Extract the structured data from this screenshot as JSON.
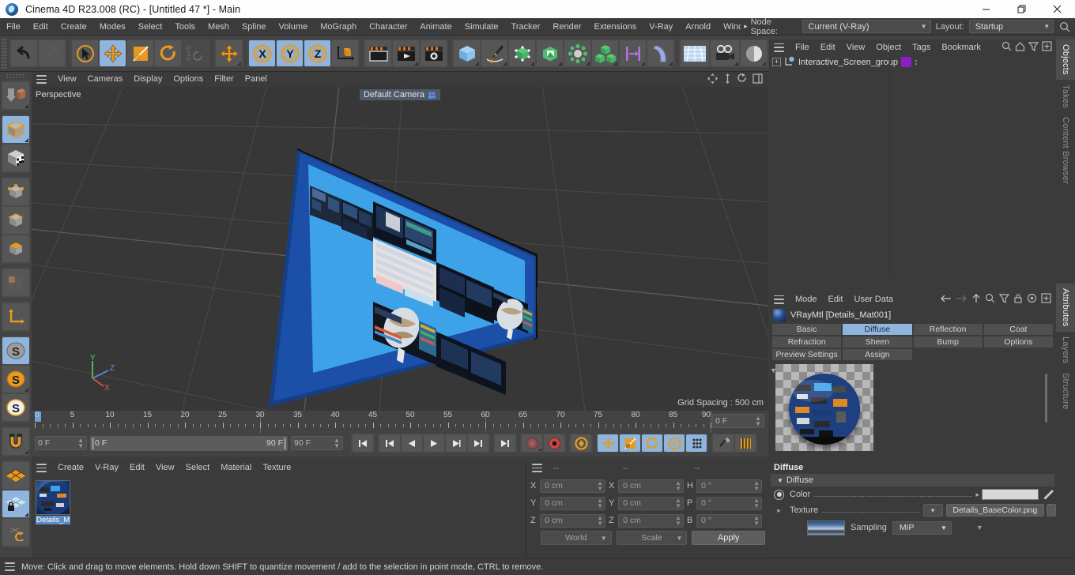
{
  "window": {
    "title": "Cinema 4D R23.008 (RC) - [Untitled 47 *] - Main",
    "minimize": "minimize-icon",
    "maximize": "restore-icon",
    "close": "close-icon"
  },
  "menubar": {
    "items": [
      "File",
      "Edit",
      "Create",
      "Modes",
      "Select",
      "Tools",
      "Mesh",
      "Spline",
      "Volume",
      "MoGraph",
      "Character",
      "Animate",
      "Simulate",
      "Tracker",
      "Render",
      "Extensions",
      "V-Ray",
      "Arnold",
      "Wind"
    ],
    "overflow": "▸",
    "node_space_label": "Node Space:",
    "node_space_value": "Current (V-Ray)",
    "layout_label": "Layout:",
    "layout_value": "Startup",
    "search_icon": "search-icon"
  },
  "toolbar": {
    "undo": "undo-icon",
    "redo": "redo-icon",
    "select": "live-selection-icon",
    "move": "move-icon",
    "scale": "scale-icon",
    "rotate": "rotate-icon",
    "psr": "psr-icon",
    "move_dup": "move-tool-icon",
    "axis_x": "X",
    "axis_y": "Y",
    "axis_z": "Z",
    "world_axis": "world-coordinate-icon",
    "render_view": "render-view-icon",
    "render_picture": "render-to-picture-viewer-icon",
    "render_settings": "render-settings-icon",
    "cube": "add-cube-icon",
    "spline_pen": "spline-pen-icon",
    "subdivision": "subdivision-surface-icon",
    "deformer": "deformer-icon",
    "mograph": "mograph-icon",
    "cloner": "cloner-icon",
    "array": "array-icon",
    "bend": "bend-deformer-icon",
    "floor": "floor-icon",
    "camera": "camera-icon",
    "light": "light-icon"
  },
  "leftbar": {
    "items": [
      {
        "name": "make-editable-icon",
        "active": false
      },
      {
        "name": "model-mode-icon",
        "active": true
      },
      {
        "name": "texture-mode-icon",
        "active": false
      },
      {
        "name": "point-mode-icon",
        "active": false
      },
      {
        "name": "edge-mode-icon",
        "active": false
      },
      {
        "name": "polygon-mode-icon",
        "active": false
      },
      {
        "name": "uv-mode-icon",
        "active": false
      },
      {
        "name": "axis-modification-icon",
        "active": false
      },
      {
        "name": "enable-axis-icon",
        "active": true
      },
      {
        "name": "world-object-axis-icon",
        "active": false
      },
      {
        "name": "object-axis-icon",
        "active": false
      },
      {
        "name": "snap-magnet-icon",
        "active": false
      },
      {
        "name": "workplane-icon",
        "active": false
      },
      {
        "name": "lock-workplane-icon",
        "active": true
      },
      {
        "name": "planar-workplane-icon",
        "active": false
      }
    ]
  },
  "viewport": {
    "menu": [
      "View",
      "Cameras",
      "Display",
      "Options",
      "Filter",
      "Panel"
    ],
    "burger": "viewport-menu-icon",
    "right_icons": [
      "move-view-icon",
      "pan-view-icon",
      "rotate-view-icon",
      "maximize-view-icon"
    ],
    "perspective_label": "Perspective",
    "camera_label": "Default Camera",
    "camera_icon": "camera-badge-icon",
    "grid_spacing": "Grid Spacing : 500 cm",
    "axis": {
      "x": "X",
      "y": "Y",
      "z": "Z",
      "x_color": "#e05555",
      "y_color": "#5ed25e",
      "z_color": "#5b8ef0"
    },
    "bg_color": "#373737",
    "object_color": "#1b4fa8",
    "screen_color": "#3ea2e8"
  },
  "timeline": {
    "ticks": [
      0,
      5,
      10,
      15,
      20,
      25,
      30,
      35,
      40,
      45,
      50,
      55,
      60,
      65,
      70,
      75,
      80,
      85,
      90
    ],
    "current_frame": "0 F",
    "start_frame": "0 F",
    "preview_start": "0 F",
    "preview_end": "90 F",
    "end_frame": "90 F",
    "buttons": [
      {
        "name": "go-to-start-button",
        "icon": "◀|",
        "active": false
      },
      {
        "name": "go-to-previous-key-button",
        "icon": "|◀",
        "active": false
      },
      {
        "name": "go-to-previous-frame-button",
        "icon": "◀◀",
        "active": false
      },
      {
        "name": "play-button",
        "icon": "▶",
        "active": false
      },
      {
        "name": "go-to-next-frame-button",
        "icon": "▶▶",
        "active": false
      },
      {
        "name": "go-to-next-key-button",
        "icon": "▶|",
        "active": false
      },
      {
        "name": "go-to-end-button",
        "icon": "|▶",
        "active": false
      }
    ],
    "record_tools": [
      "record-active-objects-icon",
      "autokeying-icon",
      "keyframe-selection-icon",
      "position-key-icon",
      "scale-key-icon",
      "rotation-key-icon",
      "parameter-key-icon",
      "point-level-animation-icon"
    ],
    "extra_tools": [
      "sound-icon",
      "timeline-icon"
    ]
  },
  "material_manager": {
    "menu": [
      "Create",
      "V-Ray",
      "Edit",
      "View",
      "Select",
      "Material",
      "Texture"
    ],
    "burger": "material-menu-icon",
    "materials": [
      {
        "name": "Details_M",
        "selected": true
      }
    ]
  },
  "coordinates": {
    "burger": "coordinates-menu-icon",
    "headers": [
      "--",
      "--",
      "--"
    ],
    "rows": [
      {
        "l1": "X",
        "v1": "0 cm",
        "l2": "X",
        "v2": "0 cm",
        "l3": "H",
        "v3": "0 °"
      },
      {
        "l1": "Y",
        "v1": "0 cm",
        "l2": "Y",
        "v2": "0 cm",
        "l3": "P",
        "v3": "0 °"
      },
      {
        "l1": "Z",
        "v1": "0 cm",
        "l2": "Z",
        "v2": "0 cm",
        "l3": "B",
        "v3": "0 °"
      }
    ],
    "system": "World",
    "mode": "Scale",
    "apply": "Apply"
  },
  "object_manager": {
    "menu": [
      "File",
      "Edit",
      "View",
      "Object",
      "Tags",
      "Bookmarks"
    ],
    "burger": "object-manager-menu-icon",
    "right_icons": [
      "search-icon",
      "home-icon",
      "filter-icon",
      "add-icon"
    ],
    "objects": [
      {
        "name": "Interactive_Screen_group",
        "expand": "+",
        "tag_color": "#8a1fc8"
      }
    ]
  },
  "attributes": {
    "menu": [
      "Mode",
      "Edit",
      "User Data"
    ],
    "burger": "attributes-menu-icon",
    "right_icons": [
      "back-arrow-icon",
      "forward-arrow-icon",
      "up-arrow-icon",
      "search-icon",
      "filter-icon",
      "lock-icon",
      "target-icon",
      "add-icon"
    ],
    "object_title": "VRayMtl [Details_Mat001]",
    "tabs": [
      {
        "label": "Basic",
        "active": false
      },
      {
        "label": "Diffuse",
        "active": true
      },
      {
        "label": "Reflection",
        "active": false
      },
      {
        "label": "Coat",
        "active": false
      },
      {
        "label": "Refraction",
        "active": false
      },
      {
        "label": "Sheen",
        "active": false
      },
      {
        "label": "Bump",
        "active": false
      },
      {
        "label": "Options",
        "active": false
      },
      {
        "label": "Preview Settings",
        "active": false
      },
      {
        "label": "Assign",
        "active": false
      }
    ],
    "section_title": "Diffuse",
    "group_title": "Diffuse",
    "color_label": "Color",
    "color_value": "#d7d7d7",
    "eyedropper": "eyedropper-icon",
    "texture_label": "Texture",
    "texture_value": "Details_BaseColor.png",
    "sampling_label": "Sampling",
    "sampling_value": "MIP"
  },
  "vertical_tabs": {
    "top": [
      {
        "label": "Objects",
        "active": true
      },
      {
        "label": "Takes",
        "active": false
      },
      {
        "label": "Content Browser",
        "active": false
      }
    ],
    "bottom": [
      {
        "label": "Attributes",
        "active": true
      },
      {
        "label": "Layers",
        "active": false
      },
      {
        "label": "Structure",
        "active": false
      }
    ]
  },
  "statusbar": {
    "burger": "status-menu-icon",
    "text": "Move: Click and drag to move elements. Hold down SHIFT to quantize movement / add to the selection in point mode, CTRL to remove."
  }
}
